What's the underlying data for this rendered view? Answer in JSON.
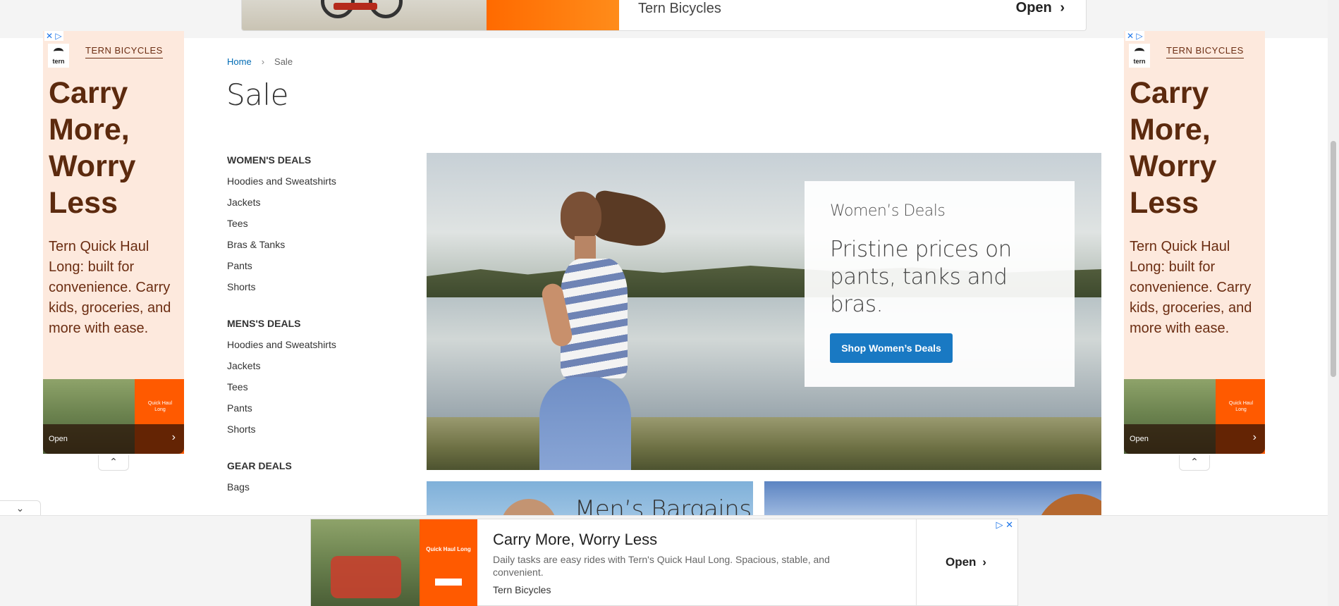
{
  "top_ad": {
    "brand": "Tern Bicycles",
    "open_label": "Open",
    "chevron": "›"
  },
  "side_ad": {
    "adchoices": "✕ ▷",
    "logo_text": "tern",
    "brand": "TERN BICYCLES",
    "headline": "Carry More, Worry Less",
    "body": "Tern Quick Haul Long: built for convenience. Carry kids, groceries, and more with ease.",
    "image_text": "Quick Haul Long",
    "open_label": "Open",
    "chevron": "›",
    "collapse_icon": "⌃"
  },
  "expand_icon": "⌄",
  "breadcrumb": {
    "home": "Home",
    "separator": "›",
    "current": "Sale"
  },
  "page_title": "Sale",
  "sidebar": {
    "groups": [
      {
        "title": "WOMEN'S DEALS",
        "items": [
          "Hoodies and Sweatshirts",
          "Jackets",
          "Tees",
          "Bras & Tanks",
          "Pants",
          "Shorts"
        ]
      },
      {
        "title": "MENS'S DEALS",
        "items": [
          "Hoodies and Sweatshirts",
          "Jackets",
          "Tees",
          "Pants",
          "Shorts"
        ]
      },
      {
        "title": "GEAR DEALS",
        "items": [
          "Bags"
        ]
      }
    ]
  },
  "hero": {
    "eyebrow": "Women’s Deals",
    "headline": "Pristine prices on pants, tanks and bras.",
    "cta": "Shop Women’s Deals"
  },
  "tiles": {
    "men_title": "Men’s Bargains"
  },
  "bottom_ad": {
    "adchoices": "▷ ✕",
    "image_text": "Quick Haul Long",
    "headline": "Carry More, Worry Less",
    "description": "Daily tasks are easy rides with Tern's Quick Haul Long. Spacious, stable, and convenient.",
    "brand": "Tern Bicycles",
    "open_label": "Open",
    "chevron": "›"
  },
  "colors": {
    "link": "#006bb4",
    "cta_bg": "#1979c3",
    "ad_bg": "#fde9dd",
    "ad_text": "#5c2a0e",
    "ad_orange": "#ff5a00"
  }
}
